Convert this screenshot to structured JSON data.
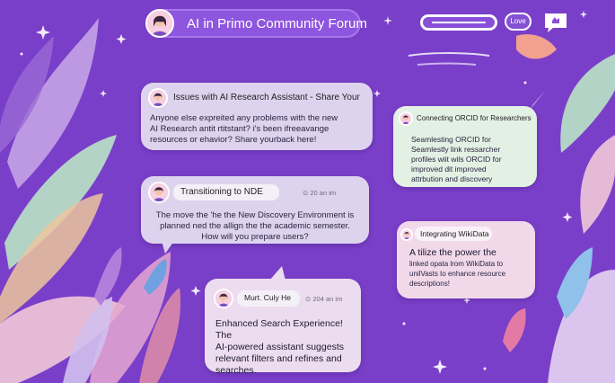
{
  "header": {
    "title": "AI in Primo Community Forum",
    "love_label": "Love"
  },
  "posts": [
    {
      "title": "Issues with AI Research Assistant - Share Your",
      "body_lines": [
        "Anyone else expreited any problems with the new",
        "AI Research antit rtitstant? i's been ifreeavange",
        "resources or ehavior? Share yourback here!"
      ]
    },
    {
      "title": "Transitioning to NDE",
      "meta": "20 an im",
      "body_lines": [
        "The move the 'he the New Discovery Environment is",
        "planned ned the allign the the academic semester.",
        "How will you prepare users?"
      ]
    },
    {
      "title": "Murt. Culy He",
      "meta": "204 an im",
      "body_lines": [
        "Enhanced Search Experience! The",
        "AI-powered assistant suggests",
        "relevant filters and refines and",
        "searches."
      ]
    },
    {
      "title": "Connecting ORCID for Researchers",
      "body_lines": [
        "Seamlesting ORCID for",
        "Seamlestly link ressarcher",
        "profiles wiit wils ORCID for",
        "improved dit improved",
        "attrbution and discovery"
      ]
    },
    {
      "title": "Integrating WikiData",
      "body_lines": [
        "A tilize the power the",
        "linked opata lrom WikiData to",
        "unilVasts to enhance resource",
        "descriptions!"
      ]
    }
  ],
  "colors": {
    "background": "#7a3fc9",
    "card_lavender": "#ddd3ee",
    "card_mint": "#e3f1e4",
    "card_pink": "#f1d9ea",
    "card_light": "#ecdcef"
  }
}
